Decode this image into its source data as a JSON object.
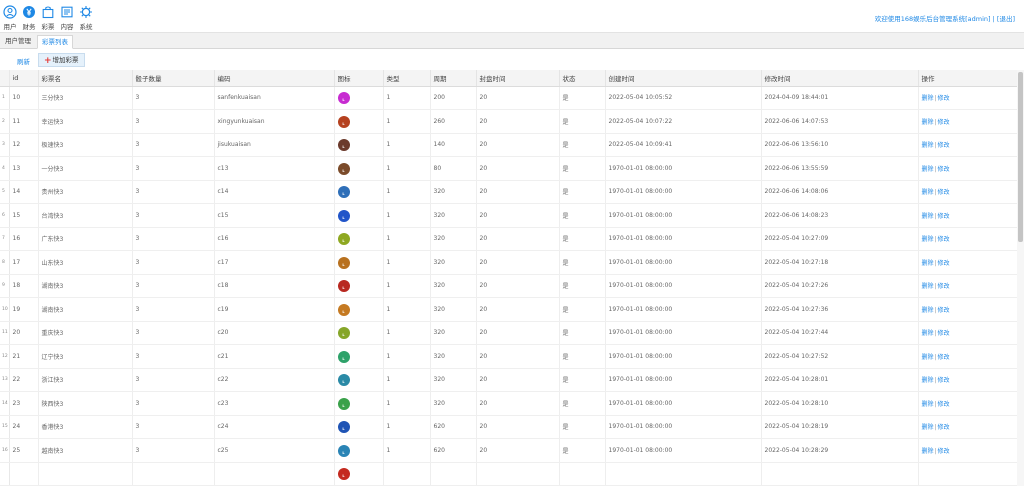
{
  "nav": [
    {
      "label": "用户",
      "icon": "user-icon"
    },
    {
      "label": "财务",
      "icon": "yen-icon"
    },
    {
      "label": "彩票",
      "icon": "bag-icon"
    },
    {
      "label": "内容",
      "icon": "content-icon"
    },
    {
      "label": "系统",
      "icon": "settings-icon"
    }
  ],
  "user": {
    "welcome": "欢迎使用168娱乐后台管理系统",
    "name": "[admin]",
    "separator": " | ",
    "logout": "[退出]"
  },
  "tabs": [
    "用户管理",
    "彩票列表"
  ],
  "toolbar": {
    "refresh": "刷新",
    "add": "增加彩票"
  },
  "columns": [
    "",
    "id",
    "彩票名",
    "骰子数量",
    "编码",
    "图标",
    "类型",
    "周期",
    "封盘时间",
    "状态",
    "创建时间",
    "修改时间",
    "操作"
  ],
  "actions": {
    "delete": "删除",
    "separator": "|",
    "edit": "修改"
  },
  "colors": {
    "accent": "#1e88e5",
    "add_plus": "#e53935"
  },
  "rows": [
    {
      "n": "1",
      "id": "10",
      "name": "三分快3",
      "dice": "3",
      "code": "sanfenkuaisan",
      "icon_color": "#c72bd1",
      "type": "1",
      "period": "200",
      "close": "20",
      "status": "是",
      "created": "2022-05-04 10:05:52",
      "modified": "2024-04-09 18:44:01"
    },
    {
      "n": "2",
      "id": "11",
      "name": "幸运快3",
      "dice": "3",
      "code": "xingyunkuaisan",
      "icon_color": "#b5411f",
      "type": "1",
      "period": "260",
      "close": "20",
      "status": "是",
      "created": "2022-05-04 10:07:22",
      "modified": "2022-06-06 14:07:53"
    },
    {
      "n": "3",
      "id": "12",
      "name": "极速快3",
      "dice": "3",
      "code": "jisukuaisan",
      "icon_color": "#6b3a2c",
      "type": "1",
      "period": "140",
      "close": "20",
      "status": "是",
      "created": "2022-05-04 10:09:41",
      "modified": "2022-06-06 13:56:10"
    },
    {
      "n": "4",
      "id": "13",
      "name": "一分快3",
      "dice": "3",
      "code": "c13",
      "icon_color": "#7b4b2a",
      "type": "1",
      "period": "80",
      "close": "20",
      "status": "是",
      "created": "1970-01-01 08:00:00",
      "modified": "2022-06-06 13:55:59"
    },
    {
      "n": "5",
      "id": "14",
      "name": "贵州快3",
      "dice": "3",
      "code": "c14",
      "icon_color": "#2f6fb8",
      "type": "1",
      "period": "320",
      "close": "20",
      "status": "是",
      "created": "1970-01-01 08:00:00",
      "modified": "2022-06-06 14:08:06"
    },
    {
      "n": "6",
      "id": "15",
      "name": "台湾快3",
      "dice": "3",
      "code": "c15",
      "icon_color": "#2155c9",
      "type": "1",
      "period": "320",
      "close": "20",
      "status": "是",
      "created": "1970-01-01 08:00:00",
      "modified": "2022-06-06 14:08:23"
    },
    {
      "n": "7",
      "id": "16",
      "name": "广东快3",
      "dice": "3",
      "code": "c16",
      "icon_color": "#8ea821",
      "type": "1",
      "period": "320",
      "close": "20",
      "status": "是",
      "created": "1970-01-01 08:00:00",
      "modified": "2022-05-04 10:27:09"
    },
    {
      "n": "8",
      "id": "17",
      "name": "山东快3",
      "dice": "3",
      "code": "c17",
      "icon_color": "#b8711f",
      "type": "1",
      "period": "320",
      "close": "20",
      "status": "是",
      "created": "1970-01-01 08:00:00",
      "modified": "2022-05-04 10:27:18"
    },
    {
      "n": "9",
      "id": "18",
      "name": "湖南快3",
      "dice": "3",
      "code": "c18",
      "icon_color": "#b82820",
      "type": "1",
      "period": "320",
      "close": "20",
      "status": "是",
      "created": "1970-01-01 08:00:00",
      "modified": "2022-05-04 10:27:26"
    },
    {
      "n": "10",
      "id": "19",
      "name": "湖南快3",
      "dice": "3",
      "code": "c19",
      "icon_color": "#c57a22",
      "type": "1",
      "period": "320",
      "close": "20",
      "status": "是",
      "created": "1970-01-01 08:00:00",
      "modified": "2022-05-04 10:27:36"
    },
    {
      "n": "11",
      "id": "20",
      "name": "重庆快3",
      "dice": "3",
      "code": "c20",
      "icon_color": "#86a629",
      "type": "1",
      "period": "320",
      "close": "20",
      "status": "是",
      "created": "1970-01-01 08:00:00",
      "modified": "2022-05-04 10:27:44"
    },
    {
      "n": "12",
      "id": "21",
      "name": "辽宁快3",
      "dice": "3",
      "code": "c21",
      "icon_color": "#2ea26a",
      "type": "1",
      "period": "320",
      "close": "20",
      "status": "是",
      "created": "1970-01-01 08:00:00",
      "modified": "2022-05-04 10:27:52"
    },
    {
      "n": "13",
      "id": "22",
      "name": "浙江快3",
      "dice": "3",
      "code": "c22",
      "icon_color": "#2a8aa6",
      "type": "1",
      "period": "320",
      "close": "20",
      "status": "是",
      "created": "1970-01-01 08:00:00",
      "modified": "2022-05-04 10:28:01"
    },
    {
      "n": "14",
      "id": "23",
      "name": "陕西快3",
      "dice": "3",
      "code": "c23",
      "icon_color": "#3aa14a",
      "type": "1",
      "period": "320",
      "close": "20",
      "status": "是",
      "created": "1970-01-01 08:00:00",
      "modified": "2022-05-04 10:28:10"
    },
    {
      "n": "15",
      "id": "24",
      "name": "香港快3",
      "dice": "3",
      "code": "c24",
      "icon_color": "#1f54b5",
      "type": "1",
      "period": "620",
      "close": "20",
      "status": "是",
      "created": "1970-01-01 08:00:00",
      "modified": "2022-05-04 10:28:19"
    },
    {
      "n": "16",
      "id": "25",
      "name": "越南快3",
      "dice": "3",
      "code": "c25",
      "icon_color": "#2a84b5",
      "type": "1",
      "period": "620",
      "close": "20",
      "status": "是",
      "created": "1970-01-01 08:00:00",
      "modified": "2022-05-04 10:28:29"
    },
    {
      "n": "",
      "id": "",
      "name": "",
      "dice": "",
      "code": "",
      "icon_color": "#c42a1f",
      "type": "",
      "period": "",
      "close": "",
      "status": "",
      "created": "",
      "modified": ""
    }
  ]
}
